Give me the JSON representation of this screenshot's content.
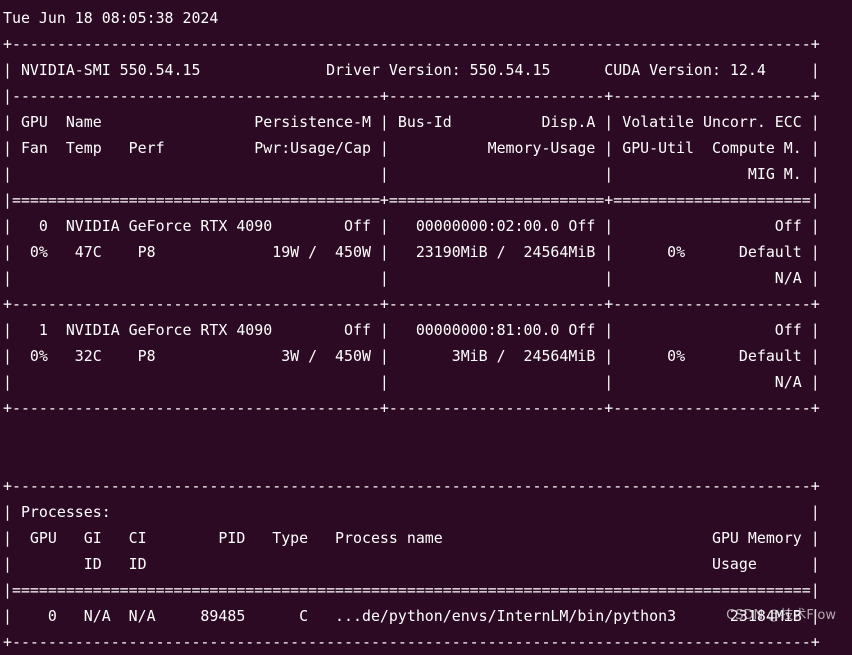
{
  "terminal": {
    "lines": [
      "Tue Jun 18 08:05:38 2024",
      "+-----------------------------------------------------------------------------------------+",
      "| NVIDIA-SMI 550.54.15              Driver Version: 550.54.15      CUDA Version: 12.4     |",
      "|-----------------------------------------+------------------------+----------------------+",
      "| GPU  Name                 Persistence-M | Bus-Id          Disp.A | Volatile Uncorr. ECC |",
      "| Fan  Temp   Perf          Pwr:Usage/Cap |           Memory-Usage | GPU-Util  Compute M. |",
      "|                                         |                        |               MIG M. |",
      "|=========================================+========================+======================|",
      "|   0  NVIDIA GeForce RTX 4090        Off |   00000000:02:00.0 Off |                  Off |",
      "|  0%   47C    P8             19W /  450W |   23190MiB /  24564MiB |      0%      Default |",
      "|                                         |                        |                  N/A |",
      "+-----------------------------------------+------------------------+----------------------+",
      "|   1  NVIDIA GeForce RTX 4090        Off |   00000000:81:00.0 Off |                  Off |",
      "|  0%   32C    P8              3W /  450W |       3MiB /  24564MiB |      0%      Default |",
      "|                                         |                        |                  N/A |",
      "+-----------------------------------------+------------------------+----------------------+",
      "",
      "",
      "+-----------------------------------------------------------------------------------------+",
      "| Processes:                                                                              |",
      "|  GPU   GI   CI        PID   Type   Process name                              GPU Memory |",
      "|        ID   ID                                                               Usage      |",
      "|=========================================================================================|",
      "|    0   N/A  N/A     89485      C   ...de/python/envs/InternLM/bin/python3      23184MiB |",
      "+-----------------------------------------------------------------------------------------+"
    ]
  },
  "watermark": "CSDN @技术Flow",
  "colors": {
    "background": "#2d0a23",
    "foreground": "#ffffff"
  }
}
